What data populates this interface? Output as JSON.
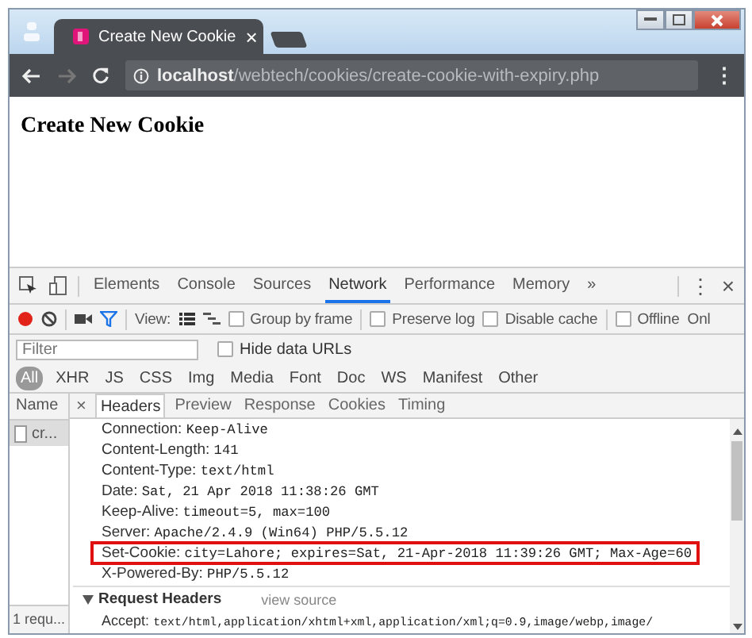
{
  "browser": {
    "tab_title": "Create New Cookie",
    "tab_close": "×",
    "url_host": "localhost",
    "url_path": "/webtech/cookies/create-cookie-with-expiry.php",
    "menu": "⋮"
  },
  "page": {
    "heading": "Create New Cookie"
  },
  "devtools": {
    "tabs": [
      {
        "label": "Elements",
        "selected": false
      },
      {
        "label": "Console",
        "selected": false
      },
      {
        "label": "Sources",
        "selected": false
      },
      {
        "label": "Network",
        "selected": true
      },
      {
        "label": "Performance",
        "selected": false
      },
      {
        "label": "Memory",
        "selected": false
      }
    ],
    "more": "»",
    "menu": "⋮",
    "close": "×",
    "toolbar": {
      "recording": true,
      "view_label": "View:",
      "options": [
        {
          "label": "Group by frame",
          "checked": false
        },
        {
          "label": "Preserve log",
          "checked": false
        },
        {
          "label": "Disable cache",
          "checked": false
        },
        {
          "label": "Offline",
          "checked": false
        }
      ],
      "cut_label": "Onl"
    },
    "filter": {
      "placeholder": "Filter",
      "hide_data_urls": {
        "label": "Hide data URLs",
        "checked": false
      }
    },
    "types": [
      {
        "label": "All",
        "selected": true
      },
      {
        "label": "XHR",
        "selected": false
      },
      {
        "label": "JS",
        "selected": false
      },
      {
        "label": "CSS",
        "selected": false
      },
      {
        "label": "Img",
        "selected": false
      },
      {
        "label": "Media",
        "selected": false
      },
      {
        "label": "Font",
        "selected": false
      },
      {
        "label": "Doc",
        "selected": false
      },
      {
        "label": "WS",
        "selected": false
      },
      {
        "label": "Manifest",
        "selected": false
      },
      {
        "label": "Other",
        "selected": false
      }
    ],
    "requests": {
      "header": "Name",
      "items": [
        "cr..."
      ],
      "status": "1 requ..."
    },
    "detail": {
      "close": "×",
      "tabs": [
        {
          "label": "Headers",
          "selected": true
        },
        {
          "label": "Preview",
          "selected": false
        },
        {
          "label": "Response",
          "selected": false
        },
        {
          "label": "Cookies",
          "selected": false
        },
        {
          "label": "Timing",
          "selected": false
        }
      ],
      "response_headers": [
        {
          "name": "Connection:",
          "value": "Keep-Alive",
          "highlighted": false
        },
        {
          "name": "Content-Length:",
          "value": "141",
          "highlighted": false
        },
        {
          "name": "Content-Type:",
          "value": "text/html",
          "highlighted": false
        },
        {
          "name": "Date:",
          "value": "Sat, 21 Apr 2018 11:38:26 GMT",
          "highlighted": false
        },
        {
          "name": "Keep-Alive:",
          "value": "timeout=5, max=100",
          "highlighted": false
        },
        {
          "name": "Server:",
          "value": "Apache/2.4.9 (Win64) PHP/5.5.12",
          "highlighted": false
        },
        {
          "name": "Set-Cookie:",
          "value": "city=Lahore; expires=Sat, 21-Apr-2018 11:39:26 GMT; Max-Age=60",
          "highlighted": true
        },
        {
          "name": "X-Powered-By:",
          "value": "PHP/5.5.12",
          "highlighted": false
        }
      ],
      "request_section": {
        "title": "Request Headers",
        "expanded": true,
        "link": "view source",
        "headers": [
          {
            "name": "Accept:",
            "value": "text/html,application/xhtml+xml,application/xml;q=0.9,image/webp,image/"
          }
        ]
      }
    }
  }
}
